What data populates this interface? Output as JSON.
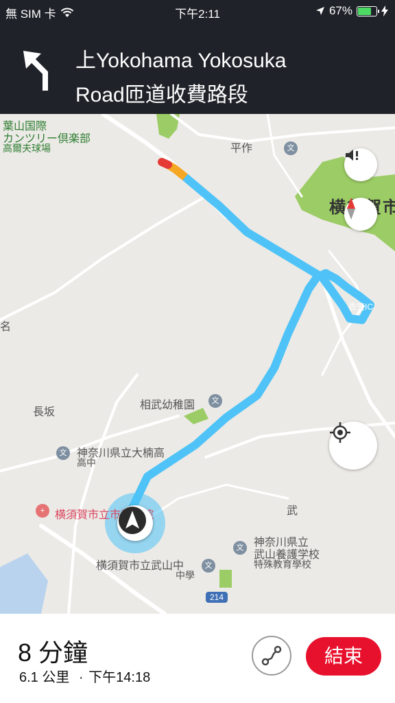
{
  "status_bar": {
    "carrier": "無 SIM 卡",
    "time": "下午2:11",
    "battery_percent": "67%",
    "battery_level": 0.67
  },
  "navigation": {
    "instruction_line1": "上Yokohama Yokosuka",
    "instruction_line2": "Road匝道收費路段",
    "turn_icon": "turn-left-arrow-icon"
  },
  "map": {
    "labels": {
      "hayama_club_1": "葉山国際",
      "hayama_club_2": "カンツリー倶楽部",
      "hayama_club_3": "高爾夫球場",
      "heisaku": "平作",
      "yokosuka_city": "横須賀市",
      "interchange": "衣笠IC",
      "nagasaka": "長坂",
      "sobu_kindergarten": "相武幼稚園",
      "kusunoki_high_1": "神奈川県立大楠高",
      "kusunoki_high_2": "高中",
      "hospital": "横須賀市立市民病院",
      "take": "武",
      "takeyama_school_1": "神奈川県立",
      "takeyama_school_2": "武山養護学校",
      "takeyama_school_3": "特殊教育學校",
      "takeyama_jhs_1": "横須賀市立武山中",
      "takeyama_jhs_2": "中學",
      "route_214": "214",
      "left_edge": "名"
    },
    "buttons": {
      "sound": "speaker-alert-icon",
      "compass": "compass-icon",
      "recenter": "locate-icon"
    },
    "colors": {
      "route": "#4fc3f7",
      "traffic_slow": "#f5a623",
      "traffic_heavy": "#e53935",
      "park": "#9ccc65"
    }
  },
  "trip": {
    "eta_duration": "8 分鐘",
    "distance": "6.1 公里",
    "separator": "·",
    "arrival_time": "下午14:18",
    "end_label": "結束"
  }
}
